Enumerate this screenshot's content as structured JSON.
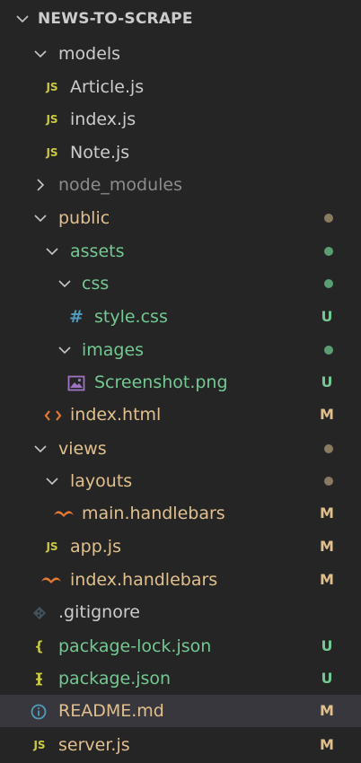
{
  "explorer": {
    "title": "NEWS-TO-SCRAPE",
    "colors": {
      "background": "#252526",
      "selected": "#37373d",
      "modified": "#e2c08d",
      "untracked": "#73c991",
      "ignored": "#8c8c8c",
      "default": "#cccccc",
      "js_icon": "#cbcb41",
      "css_icon": "#519aba",
      "html_icon": "#e37933",
      "image_icon": "#a074c4"
    },
    "items": [
      {
        "label": "models",
        "type": "folder",
        "expanded": true,
        "status": ""
      },
      {
        "label": "Article.js",
        "type": "js",
        "icon_text": "JS",
        "status": ""
      },
      {
        "label": "index.js",
        "type": "js",
        "icon_text": "JS",
        "status": ""
      },
      {
        "label": "Note.js",
        "type": "js",
        "icon_text": "JS",
        "status": ""
      },
      {
        "label": "node_modules",
        "type": "folder",
        "expanded": false,
        "status": "ignored"
      },
      {
        "label": "public",
        "type": "folder",
        "expanded": true,
        "status": "modified-dot"
      },
      {
        "label": "assets",
        "type": "folder",
        "expanded": true,
        "status": "untracked-dot"
      },
      {
        "label": "css",
        "type": "folder",
        "expanded": true,
        "status": "untracked-dot"
      },
      {
        "label": "style.css",
        "type": "css",
        "icon_text": "#",
        "status": "untracked",
        "badge": "U"
      },
      {
        "label": "images",
        "type": "folder",
        "expanded": true,
        "status": "untracked-dot"
      },
      {
        "label": "Screenshot.png",
        "type": "image",
        "status": "untracked",
        "badge": "U"
      },
      {
        "label": "index.html",
        "type": "html",
        "status": "modified",
        "badge": "M"
      },
      {
        "label": "views",
        "type": "folder",
        "expanded": true,
        "status": "modified-dot"
      },
      {
        "label": "layouts",
        "type": "folder",
        "expanded": true,
        "status": "modified-dot"
      },
      {
        "label": "main.handlebars",
        "type": "handlebars",
        "status": "modified",
        "badge": "M"
      },
      {
        "label": "app.js",
        "type": "js",
        "icon_text": "JS",
        "status": "modified",
        "badge": "M"
      },
      {
        "label": "index.handlebars",
        "type": "handlebars",
        "status": "modified",
        "badge": "M"
      },
      {
        "label": ".gitignore",
        "type": "git",
        "status": ""
      },
      {
        "label": "package-lock.json",
        "type": "json",
        "icon_text": "{ }",
        "status": "untracked",
        "badge": "U"
      },
      {
        "label": "package.json",
        "type": "json",
        "icon_text": "{ }",
        "status": "untracked",
        "badge": "U"
      },
      {
        "label": "README.md",
        "type": "info",
        "status": "modified",
        "badge": "M",
        "selected": true
      },
      {
        "label": "server.js",
        "type": "js",
        "icon_text": "JS",
        "status": "modified",
        "badge": "M"
      }
    ]
  }
}
